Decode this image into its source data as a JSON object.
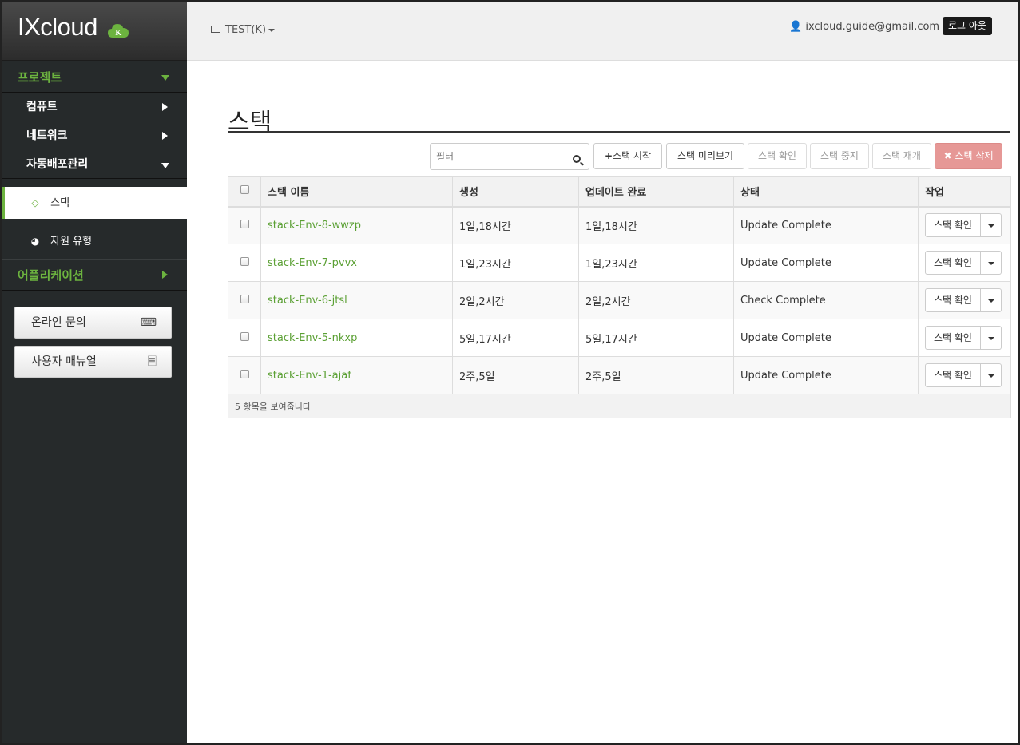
{
  "sidebar": {
    "logo": "IXcloud",
    "logo_badge": "K",
    "sections": {
      "project": "프로젝트",
      "application": "어플리케이션"
    },
    "items": {
      "compute": "컴퓨트",
      "network": "네트워크",
      "deploy": "자동배포관리"
    },
    "subitems": {
      "stack": "스택",
      "resource_type": "자원 유형"
    },
    "buttons": {
      "online_inquiry": "온라인 문의",
      "user_manual": "사용자 매뉴얼"
    }
  },
  "header": {
    "project": "TEST(K)",
    "user": "ixcloud.guide@gmail.com",
    "logout": "로그 아웃"
  },
  "main": {
    "title": "스택",
    "filter_placeholder": "필터",
    "toolbar": {
      "launch": "스택 시작",
      "preview": "스택 미리보기",
      "check": "스택 확인",
      "suspend": "스택 중지",
      "resume": "스택 재개",
      "delete": "스택 삭제"
    },
    "table": {
      "columns": [
        "스택 이름",
        "생성",
        "업데이트 완료",
        "상태",
        "작업"
      ],
      "rows": [
        {
          "name": "stack-Env-8-wwzp",
          "created": "1일,18시간",
          "updated": "1일,18시간",
          "status": "Update Complete",
          "action": "스택 확인"
        },
        {
          "name": "stack-Env-7-pvvx",
          "created": "1일,23시간",
          "updated": "1일,23시간",
          "status": "Update Complete",
          "action": "스택 확인"
        },
        {
          "name": "stack-Env-6-jtsl",
          "created": "2일,2시간",
          "updated": "2일,2시간",
          "status": "Check Complete",
          "action": "스택 확인"
        },
        {
          "name": "stack-Env-5-nkxp",
          "created": "5일,17시간",
          "updated": "5일,17시간",
          "status": "Update Complete",
          "action": "스택 확인"
        },
        {
          "name": "stack-Env-1-ajaf",
          "created": "2주,5일",
          "updated": "2주,5일",
          "status": "Update Complete",
          "action": "스택 확인"
        }
      ],
      "footer": "5 항목을 보여줍니다"
    }
  },
  "colors": {
    "accent": "#6cb33f",
    "sidebar_bg": "#262a2b",
    "danger": "#e69896"
  }
}
